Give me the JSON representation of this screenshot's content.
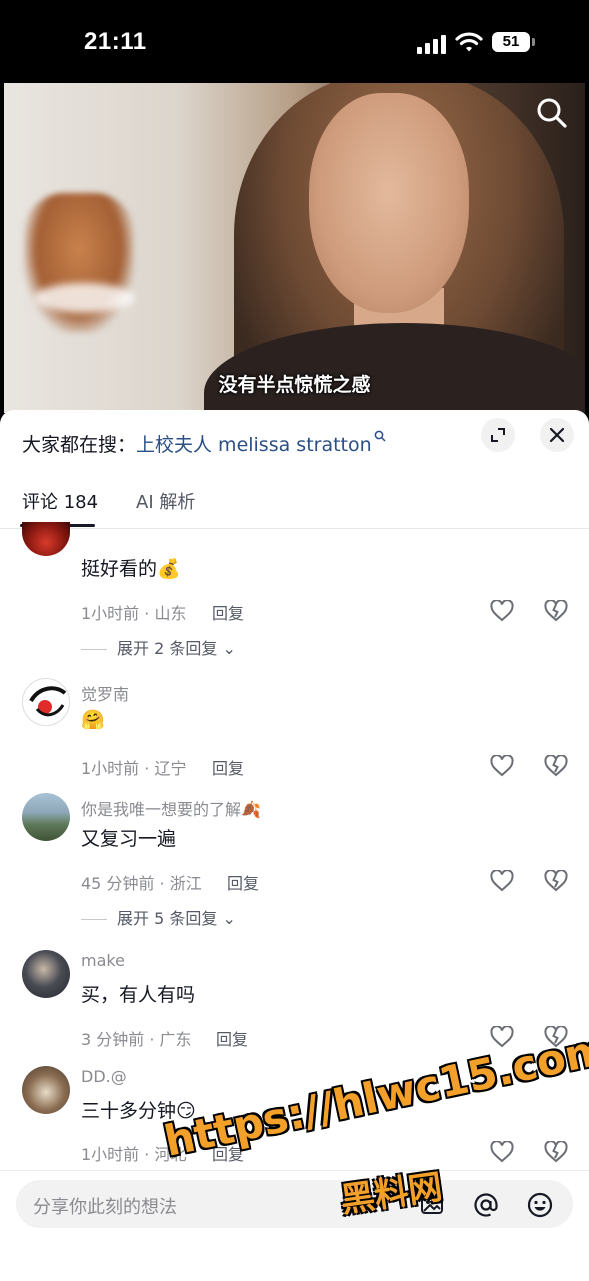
{
  "status_bar": {
    "time": "21:11",
    "battery": "51"
  },
  "video": {
    "subtitle": "没有半点惊慌之感"
  },
  "hot_search": {
    "prefix": "大家都在搜：",
    "query": "上校夫人 melissa stratton"
  },
  "tabs": [
    {
      "label": "评论 184",
      "active": true
    },
    {
      "label": "AI 解析",
      "active": false
    }
  ],
  "comments": [
    {
      "user": "",
      "text": "挺好看的",
      "emoji": "💰",
      "meta": "1小时前 · 山东",
      "reply": "回复",
      "expand": "展开 2 条回复"
    },
    {
      "user": "觉罗南",
      "text": "",
      "emoji": "🤗",
      "meta": "1小时前 · 辽宁",
      "reply": "回复",
      "expand": ""
    },
    {
      "user": "你是我唯一想要的了解",
      "text": "又复习一遍",
      "emoji": "🍂",
      "meta": "45 分钟前 · 浙江",
      "reply": "回复",
      "expand": "展开 5 条回复"
    },
    {
      "user": "make",
      "text": "买，有人有吗",
      "emoji": "",
      "meta": "3 分钟前 · 广东",
      "reply": "回复",
      "expand": ""
    },
    {
      "user": "DD.@",
      "text": "三十多分钟",
      "emoji": "😏",
      "meta": "1小时前 · 河北",
      "reply": "回复",
      "expand": ""
    }
  ],
  "input": {
    "placeholder": "分享你此刻的想法"
  },
  "watermark": {
    "url": "https://hlwc15.com",
    "name": "黑料网"
  },
  "colors": {
    "link": "#2a4f86",
    "muted": "#8a8b91",
    "watermark": "#f3a02a"
  }
}
